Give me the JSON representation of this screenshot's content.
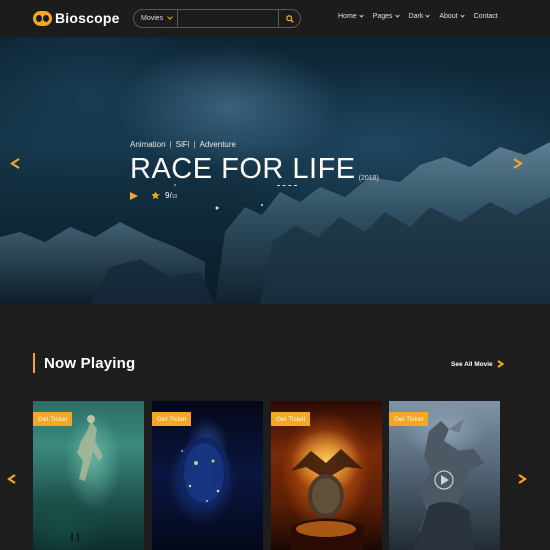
{
  "header": {
    "logo_text": "Bioscope",
    "search": {
      "category": "Movies",
      "placeholder": ""
    },
    "nav": [
      {
        "label": "Home",
        "dropdown": true
      },
      {
        "label": "Pages",
        "dropdown": true
      },
      {
        "label": "Dark",
        "dropdown": true
      },
      {
        "label": "About",
        "dropdown": true
      },
      {
        "label": "Contact",
        "dropdown": false
      }
    ]
  },
  "hero": {
    "genres": [
      "Animation",
      "SiFi",
      "Adventure"
    ],
    "title": "RACE FOR LIFE",
    "year": "(2018)",
    "rating": "9/",
    "rating_max": "10"
  },
  "now_playing": {
    "title": "Now Playing",
    "see_all": "See All Movie",
    "cards": [
      {
        "ticket": "Get Ticket",
        "image": "undersea-figure"
      },
      {
        "ticket": "Get Ticket",
        "image": "glowing-face"
      },
      {
        "ticket": "Get Ticket",
        "image": "fire-dragon-egg"
      },
      {
        "ticket": "Get Ticket",
        "image": "armored-dragon"
      }
    ]
  },
  "colors": {
    "accent": "#f5a623",
    "background": "#1d1d1d",
    "header": "#1c1c1c"
  }
}
